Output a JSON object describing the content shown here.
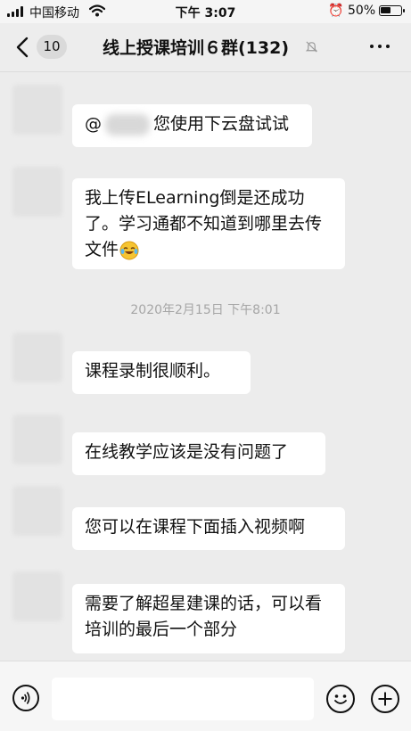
{
  "status_bar": {
    "carrier": "中国移动",
    "time": "下午 3:07",
    "battery_percent": "50%",
    "battery_level": 0.5,
    "icons": [
      "signal-icon",
      "wifi-icon",
      "alarm-icon",
      "battery-icon"
    ]
  },
  "nav_bar": {
    "unread_count": "10",
    "title": "线上授课培训６群(132)",
    "icons": [
      "back-icon",
      "mute-icon",
      "more-icon"
    ]
  },
  "messages": [
    {
      "text_before": "@",
      "text_after": "您使用下云盘试试"
    },
    {
      "text": "我上传ELearning倒是还成功了。学习通都不知道到哪里去传文件",
      "emoji": "laugh-cry-emoji"
    },
    {
      "text": "课程录制很顺利。"
    },
    {
      "text": "在线教学应该是没有问题了"
    },
    {
      "text": "您可以在课程下面插入视频啊"
    },
    {
      "text": "需要了解超星建课的话，可以看培训的最后一个部分"
    }
  ],
  "timestamp": "2020年2月15日 下午8:01",
  "input_bar": {
    "text_value": "",
    "icons": [
      "voice-icon",
      "emoji-icon",
      "plus-icon"
    ]
  },
  "colors": {
    "background": "#ececec",
    "bubble": "#ffffff",
    "timestamp_text": "#a6a6a6"
  }
}
